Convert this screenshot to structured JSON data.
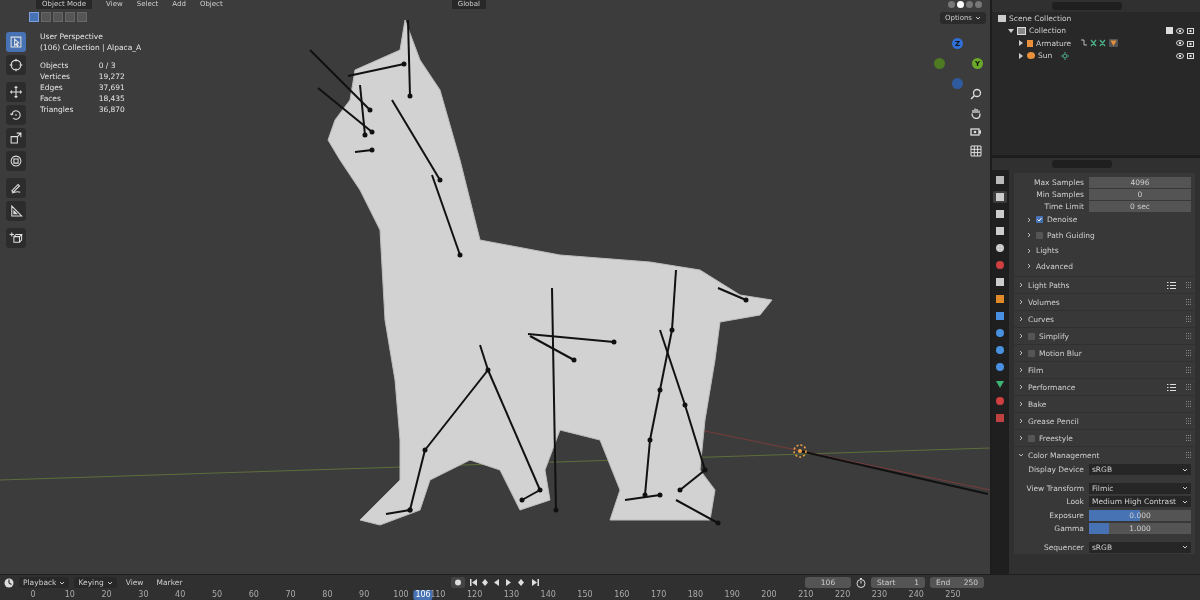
{
  "viewport_header": {
    "mode": "Object Mode",
    "menus": [
      "View",
      "Select",
      "Add",
      "Object"
    ],
    "orientation": "Global",
    "options": "Options"
  },
  "select_modes": [
    {
      "selected": true
    },
    {
      "selected": false
    },
    {
      "selected": false
    },
    {
      "selected": false
    },
    {
      "selected": false
    }
  ],
  "shading_modes": [
    {
      "selected": false
    },
    {
      "selected": true
    },
    {
      "selected": false
    },
    {
      "selected": false
    }
  ],
  "tools": [
    {
      "kind": "select",
      "selected": true
    },
    {
      "kind": "cursor",
      "selected": false
    },
    {
      "kind": "move",
      "selected": false
    },
    {
      "kind": "rotate",
      "selected": false
    },
    {
      "kind": "scale",
      "selected": false
    },
    {
      "kind": "transform",
      "selected": false
    },
    {
      "kind": "annotate",
      "selected": false
    },
    {
      "kind": "measure",
      "selected": false
    },
    {
      "kind": "add-cube",
      "selected": false
    }
  ],
  "overlay_info": {
    "view": "User Perspective",
    "context": "(106) Collection | Alpaca_A",
    "stats": [
      {
        "label": "Objects",
        "value": "0 / 3"
      },
      {
        "label": "Vertices",
        "value": "19,272"
      },
      {
        "label": "Edges",
        "value": "37,691"
      },
      {
        "label": "Faces",
        "value": "18,435"
      },
      {
        "label": "Triangles",
        "value": "36,870"
      }
    ]
  },
  "gizmo_axes": [
    {
      "label": "Z",
      "kind": "z"
    },
    {
      "kind": "y-neg"
    },
    {
      "label": "Y",
      "kind": "y"
    },
    {
      "kind": "z-neg"
    }
  ],
  "outliner": {
    "items": [
      {
        "label": "Scene Collection",
        "kind": "scene",
        "children": [
          {
            "label": "Collection",
            "kind": "collection",
            "expanded": true,
            "checked": true,
            "children": [
              {
                "label": "Armature",
                "kind": "armature",
                "expanded": false
              },
              {
                "label": "Sun",
                "kind": "light",
                "expanded": false
              }
            ]
          }
        ]
      }
    ]
  },
  "properties": {
    "tabs": [
      {
        "kind": "tool",
        "selected": false
      },
      {
        "kind": "render",
        "selected": true
      },
      {
        "kind": "output",
        "selected": false
      },
      {
        "kind": "view-layer",
        "selected": false
      },
      {
        "kind": "scene",
        "selected": false
      },
      {
        "kind": "world",
        "selected": false
      },
      {
        "kind": "collection",
        "selected": false
      },
      {
        "kind": "object",
        "selected": false
      },
      {
        "kind": "modifier",
        "selected": false
      },
      {
        "kind": "particles",
        "selected": false
      },
      {
        "kind": "physics",
        "selected": false
      },
      {
        "kind": "constraints",
        "selected": false
      },
      {
        "kind": "data",
        "selected": false
      },
      {
        "kind": "material",
        "selected": false
      },
      {
        "kind": "texture",
        "selected": false
      }
    ],
    "sampling": [
      {
        "label": "Max Samples",
        "value": "4096"
      },
      {
        "label": "Min Samples",
        "value": "0"
      },
      {
        "label": "Time Limit",
        "value": "0 sec"
      }
    ],
    "subpanels": [
      {
        "label": "Denoise",
        "kind": "toggle",
        "checked": true
      },
      {
        "label": "Path Guiding",
        "kind": "toggle",
        "checked": false
      },
      {
        "label": "Lights",
        "kind": "plain"
      },
      {
        "label": "Advanced",
        "kind": "plain"
      }
    ],
    "panels": [
      {
        "label": "Light Paths",
        "kind": "plain",
        "presets": true
      },
      {
        "label": "Volumes",
        "kind": "plain",
        "presets": false
      },
      {
        "label": "Curves",
        "kind": "plain",
        "presets": false
      },
      {
        "label": "Simplify",
        "kind": "toggle",
        "checked": false,
        "presets": false
      },
      {
        "label": "Motion Blur",
        "kind": "toggle",
        "checked": false,
        "presets": false
      },
      {
        "label": "Film",
        "kind": "plain",
        "presets": false
      },
      {
        "label": "Performance",
        "kind": "plain",
        "presets": true
      },
      {
        "label": "Bake",
        "kind": "plain",
        "presets": false
      },
      {
        "label": "Grease Pencil",
        "kind": "plain",
        "presets": false
      },
      {
        "label": "Freestyle",
        "kind": "toggle",
        "checked": false,
        "presets": false
      }
    ],
    "color_management": {
      "label": "Color Management",
      "expanded": true,
      "fields": [
        {
          "label": "Display Device",
          "kind": "dropdown",
          "value": "sRGB"
        },
        {
          "label": "View Transform",
          "kind": "dropdown",
          "value": "Filmic"
        },
        {
          "label": "Look",
          "kind": "dropdown",
          "value": "Medium High Contrast"
        },
        {
          "label": "Exposure",
          "kind": "slider",
          "value": "0.000",
          "level": 0.5
        },
        {
          "label": "Gamma",
          "kind": "slider",
          "value": "1.000",
          "level": 0.2
        },
        {
          "label": "Sequencer",
          "kind": "dropdown",
          "value": "sRGB"
        }
      ]
    }
  },
  "timeline": {
    "menus": [
      "Playback",
      "Keying",
      "View",
      "Marker"
    ],
    "current_frame": "106",
    "start_label": "Start",
    "start": "1",
    "end_label": "End",
    "end": "250",
    "ruler": [
      "0",
      "10",
      "20",
      "30",
      "40",
      "50",
      "60",
      "70",
      "80",
      "90",
      "100",
      "110",
      "120",
      "130",
      "140",
      "150",
      "160",
      "170",
      "180",
      "190",
      "200",
      "210",
      "220",
      "230",
      "240",
      "250"
    ],
    "ruler_current": "106"
  }
}
